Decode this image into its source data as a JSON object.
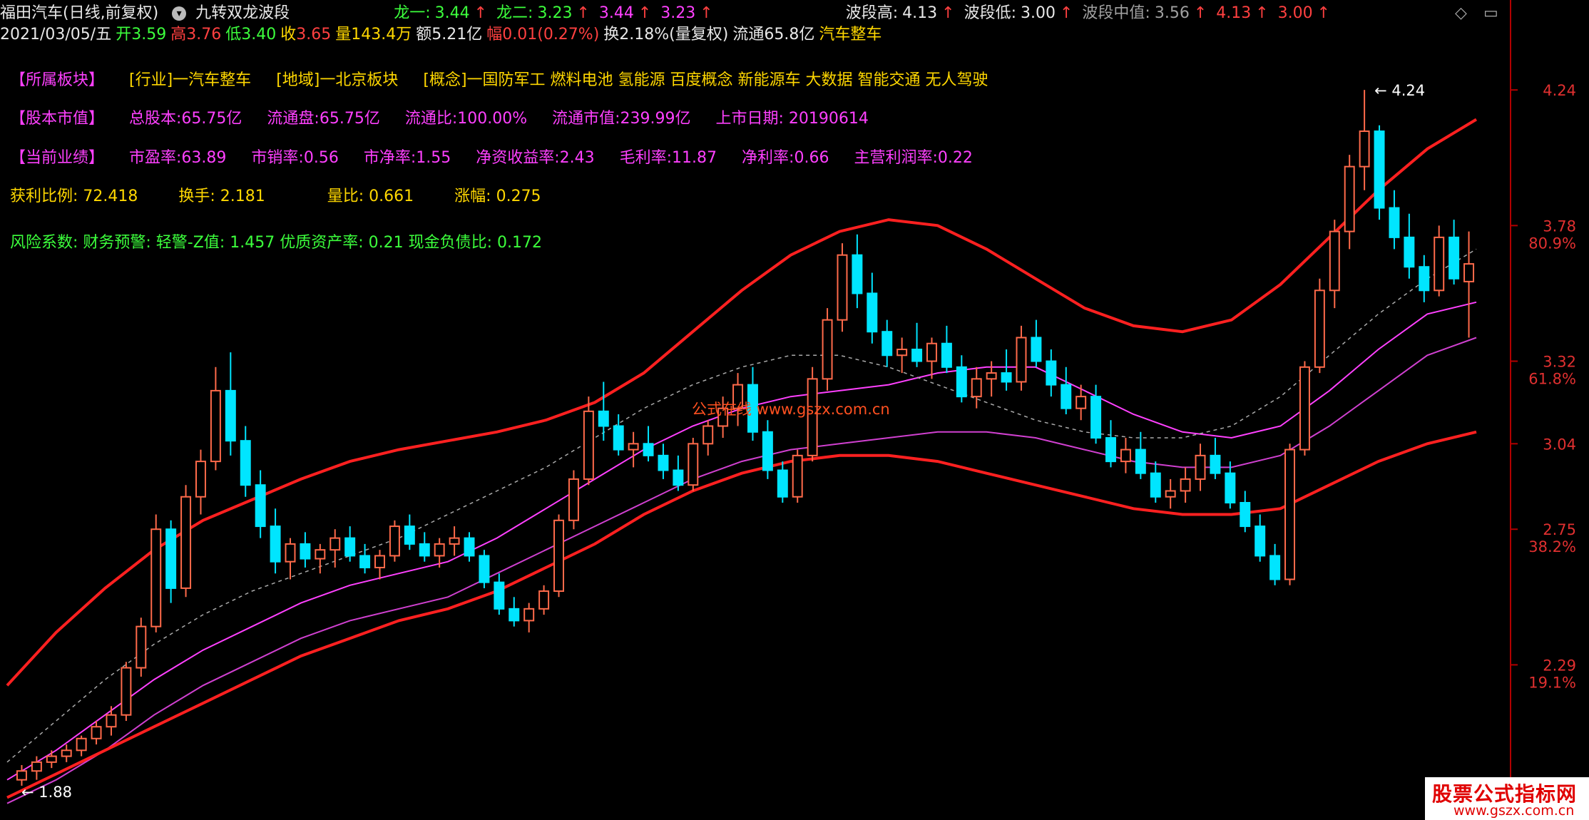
{
  "header": {
    "stock_name": "福田汽车(日线,前复权)",
    "indicator_name": "九转双龙波段",
    "long1_label": "龙一:",
    "long1_value": "3.44",
    "long2_label": "龙二:",
    "long2_value": "3.23",
    "extra1": "3.44",
    "extra2": "3.23",
    "wave_high_label": "波段高:",
    "wave_high_value": "4.13",
    "wave_low_label": "波段低:",
    "wave_low_value": "3.00",
    "wave_mid_label": "波段中值:",
    "wave_mid_value": "3.56",
    "extra3": "4.13",
    "extra4": "3.00",
    "arrow": "↑"
  },
  "quote": {
    "date": "2021/03/05/五",
    "open_label": "开",
    "open": "3.59",
    "high_label": "高",
    "high": "3.76",
    "low_label": "低",
    "low": "3.40",
    "close_label": "收",
    "close": "3.65",
    "vol_label": "量",
    "vol": "143.4万",
    "amount_label": "额",
    "amount": "5.21亿",
    "change_label": "幅",
    "change": "0.01(0.27%)",
    "turnover": "换2.18%(量复权)",
    "float": "流通65.8亿",
    "sector": "汽车整车"
  },
  "info": {
    "board_title": "【所属板块】",
    "industry": "[行业]一汽车整车",
    "region": "[地域]一北京板块",
    "concept": "[概念]一国防军工 燃料电池 氢能源 百度概念 新能源车 大数据 智能交通 无人驾驶",
    "capital_title": "【股本市值】",
    "total_shares": "总股本:65.75亿",
    "float_shares": "流通盘:65.75亿",
    "float_ratio": "流通比:100.00%",
    "float_cap": "流通市值:239.99亿",
    "list_date": "上市日期: 20190614",
    "perf_title": "【当前业绩】",
    "pe": "市盈率:63.89",
    "ps": "市销率:0.56",
    "pb": "市净率:1.55",
    "roe": "净资收益率:2.43",
    "gross": "毛利率:11.87",
    "net": "净利率:0.66",
    "main_profit": "主营利润率:0.22",
    "profit_ratio": "获利比例: 72.418",
    "turnover": "换手: 2.181",
    "vol_ratio": "量比: 0.661",
    "pct": "涨幅: 0.275",
    "risk": "风险系数: 财务预警: 轻警-Z值: 1.457 优质资产率: 0.21 现金负债比: 0.172"
  },
  "watermark": "公式在线  www.gszx.com.cn",
  "badge": {
    "title": "股票公式指标网",
    "url": "www.gszx.com.cn"
  },
  "controls": {
    "diamond": "◇",
    "window": "▭"
  },
  "chart_data": {
    "type": "candlestick",
    "y_axis_ticks": [
      {
        "price": 4.24,
        "label": "4.24"
      },
      {
        "price": 3.78,
        "label": "3.78",
        "pct": "80.9%"
      },
      {
        "price": 3.32,
        "label": "3.32",
        "pct": "61.8%"
      },
      {
        "price": 3.04,
        "label": "3.04"
      },
      {
        "price": 2.75,
        "label": "2.75",
        "pct": "38.2%"
      },
      {
        "price": 2.29,
        "label": "2.29",
        "pct": "19.1%"
      }
    ],
    "high_mark": "4.24",
    "low_mark": "1.88",
    "ylim": [
      1.8,
      4.4
    ],
    "candles": [
      [
        1.9,
        1.95,
        1.88,
        1.93
      ],
      [
        1.93,
        1.98,
        1.9,
        1.96
      ],
      [
        1.96,
        2.0,
        1.94,
        1.98
      ],
      [
        1.98,
        2.02,
        1.96,
        2.0
      ],
      [
        2.0,
        2.05,
        1.98,
        2.04
      ],
      [
        2.04,
        2.1,
        2.02,
        2.08
      ],
      [
        2.08,
        2.15,
        2.05,
        2.12
      ],
      [
        2.12,
        2.3,
        2.1,
        2.28
      ],
      [
        2.28,
        2.45,
        2.25,
        2.42
      ],
      [
        2.42,
        2.8,
        2.4,
        2.75
      ],
      [
        2.75,
        2.78,
        2.5,
        2.55
      ],
      [
        2.55,
        2.9,
        2.52,
        2.86
      ],
      [
        2.86,
        3.02,
        2.8,
        2.98
      ],
      [
        2.98,
        3.3,
        2.95,
        3.22
      ],
      [
        3.22,
        3.35,
        3.0,
        3.05
      ],
      [
        3.05,
        3.1,
        2.86,
        2.9
      ],
      [
        2.9,
        2.95,
        2.72,
        2.76
      ],
      [
        2.76,
        2.82,
        2.6,
        2.64
      ],
      [
        2.64,
        2.72,
        2.58,
        2.7
      ],
      [
        2.7,
        2.74,
        2.62,
        2.65
      ],
      [
        2.65,
        2.7,
        2.6,
        2.68
      ],
      [
        2.68,
        2.75,
        2.62,
        2.72
      ],
      [
        2.72,
        2.76,
        2.64,
        2.66
      ],
      [
        2.66,
        2.7,
        2.6,
        2.62
      ],
      [
        2.62,
        2.68,
        2.58,
        2.66
      ],
      [
        2.66,
        2.78,
        2.64,
        2.76
      ],
      [
        2.76,
        2.8,
        2.68,
        2.7
      ],
      [
        2.7,
        2.74,
        2.64,
        2.66
      ],
      [
        2.66,
        2.72,
        2.62,
        2.7
      ],
      [
        2.7,
        2.76,
        2.66,
        2.72
      ],
      [
        2.72,
        2.74,
        2.64,
        2.66
      ],
      [
        2.66,
        2.68,
        2.55,
        2.57
      ],
      [
        2.57,
        2.6,
        2.46,
        2.48
      ],
      [
        2.48,
        2.52,
        2.42,
        2.44
      ],
      [
        2.44,
        2.5,
        2.4,
        2.48
      ],
      [
        2.48,
        2.56,
        2.46,
        2.54
      ],
      [
        2.54,
        2.8,
        2.52,
        2.78
      ],
      [
        2.78,
        2.95,
        2.75,
        2.92
      ],
      [
        2.92,
        3.2,
        2.9,
        3.15
      ],
      [
        3.15,
        3.25,
        3.05,
        3.1
      ],
      [
        3.1,
        3.14,
        3.0,
        3.02
      ],
      [
        3.02,
        3.08,
        2.96,
        3.04
      ],
      [
        3.04,
        3.1,
        2.98,
        3.0
      ],
      [
        3.0,
        3.04,
        2.92,
        2.95
      ],
      [
        2.95,
        3.0,
        2.88,
        2.9
      ],
      [
        2.9,
        3.06,
        2.88,
        3.04
      ],
      [
        3.04,
        3.12,
        3.0,
        3.1
      ],
      [
        3.1,
        3.2,
        3.06,
        3.16
      ],
      [
        3.16,
        3.28,
        3.1,
        3.24
      ],
      [
        3.24,
        3.3,
        3.05,
        3.08
      ],
      [
        3.08,
        3.12,
        2.92,
        2.95
      ],
      [
        2.95,
        2.98,
        2.84,
        2.86
      ],
      [
        2.86,
        3.02,
        2.84,
        3.0
      ],
      [
        3.0,
        3.3,
        2.98,
        3.26
      ],
      [
        3.26,
        3.5,
        3.22,
        3.46
      ],
      [
        3.46,
        3.72,
        3.42,
        3.68
      ],
      [
        3.68,
        3.75,
        3.5,
        3.55
      ],
      [
        3.55,
        3.62,
        3.38,
        3.42
      ],
      [
        3.42,
        3.46,
        3.3,
        3.34
      ],
      [
        3.34,
        3.4,
        3.28,
        3.36
      ],
      [
        3.36,
        3.45,
        3.3,
        3.32
      ],
      [
        3.32,
        3.4,
        3.26,
        3.38
      ],
      [
        3.38,
        3.44,
        3.28,
        3.3
      ],
      [
        3.3,
        3.34,
        3.18,
        3.2
      ],
      [
        3.2,
        3.3,
        3.16,
        3.26
      ],
      [
        3.26,
        3.32,
        3.2,
        3.28
      ],
      [
        3.28,
        3.36,
        3.22,
        3.25
      ],
      [
        3.25,
        3.44,
        3.22,
        3.4
      ],
      [
        3.4,
        3.46,
        3.3,
        3.32
      ],
      [
        3.32,
        3.36,
        3.2,
        3.24
      ],
      [
        3.24,
        3.3,
        3.14,
        3.16
      ],
      [
        3.16,
        3.24,
        3.12,
        3.2
      ],
      [
        3.2,
        3.24,
        3.04,
        3.06
      ],
      [
        3.06,
        3.12,
        2.96,
        2.98
      ],
      [
        2.98,
        3.06,
        2.94,
        3.02
      ],
      [
        3.02,
        3.08,
        2.92,
        2.94
      ],
      [
        2.94,
        2.98,
        2.84,
        2.86
      ],
      [
        2.86,
        2.92,
        2.82,
        2.88
      ],
      [
        2.88,
        2.96,
        2.84,
        2.92
      ],
      [
        2.92,
        3.04,
        2.88,
        3.0
      ],
      [
        3.0,
        3.06,
        2.92,
        2.94
      ],
      [
        2.94,
        2.98,
        2.82,
        2.84
      ],
      [
        2.84,
        2.88,
        2.74,
        2.76
      ],
      [
        2.76,
        2.8,
        2.64,
        2.66
      ],
      [
        2.66,
        2.7,
        2.56,
        2.58
      ],
      [
        2.58,
        3.04,
        2.56,
        3.02
      ],
      [
        3.02,
        3.32,
        3.0,
        3.3
      ],
      [
        3.3,
        3.6,
        3.28,
        3.56
      ],
      [
        3.56,
        3.8,
        3.5,
        3.76
      ],
      [
        3.76,
        4.02,
        3.7,
        3.98
      ],
      [
        3.98,
        4.24,
        3.9,
        4.1
      ],
      [
        4.1,
        4.12,
        3.8,
        3.84
      ],
      [
        3.84,
        3.9,
        3.7,
        3.74
      ],
      [
        3.74,
        3.82,
        3.6,
        3.64
      ],
      [
        3.64,
        3.68,
        3.52,
        3.56
      ],
      [
        3.56,
        3.78,
        3.54,
        3.74
      ],
      [
        3.74,
        3.8,
        3.58,
        3.6
      ],
      [
        3.59,
        3.76,
        3.4,
        3.65
      ]
    ],
    "upper_band": [
      2.22,
      2.4,
      2.55,
      2.68,
      2.78,
      2.85,
      2.92,
      2.98,
      3.02,
      3.05,
      3.08,
      3.12,
      3.18,
      3.28,
      3.42,
      3.56,
      3.68,
      3.76,
      3.8,
      3.78,
      3.7,
      3.6,
      3.5,
      3.44,
      3.42,
      3.46,
      3.58,
      3.74,
      3.9,
      4.04,
      4.14
    ],
    "lower_band": [
      1.84,
      1.92,
      2.0,
      2.08,
      2.16,
      2.24,
      2.32,
      2.38,
      2.44,
      2.48,
      2.54,
      2.62,
      2.7,
      2.8,
      2.88,
      2.94,
      2.98,
      3.0,
      3.0,
      2.98,
      2.94,
      2.9,
      2.86,
      2.82,
      2.8,
      2.8,
      2.82,
      2.9,
      2.98,
      3.04,
      3.08
    ],
    "mid_line": [
      1.96,
      2.1,
      2.24,
      2.36,
      2.46,
      2.54,
      2.6,
      2.66,
      2.72,
      2.8,
      2.88,
      2.96,
      3.06,
      3.16,
      3.24,
      3.3,
      3.34,
      3.34,
      3.3,
      3.24,
      3.18,
      3.12,
      3.08,
      3.06,
      3.06,
      3.1,
      3.2,
      3.34,
      3.48,
      3.6,
      3.7
    ],
    "magenta_upper": [
      1.9,
      2.0,
      2.12,
      2.24,
      2.34,
      2.42,
      2.5,
      2.56,
      2.6,
      2.64,
      2.72,
      2.82,
      2.92,
      3.02,
      3.1,
      3.16,
      3.2,
      3.22,
      3.24,
      3.28,
      3.3,
      3.3,
      3.22,
      3.14,
      3.08,
      3.06,
      3.1,
      3.22,
      3.36,
      3.48,
      3.52
    ],
    "magenta_lower": [
      1.82,
      1.9,
      2.0,
      2.12,
      2.22,
      2.3,
      2.38,
      2.44,
      2.48,
      2.52,
      2.6,
      2.68,
      2.76,
      2.84,
      2.92,
      2.98,
      3.02,
      3.04,
      3.06,
      3.08,
      3.08,
      3.06,
      3.02,
      2.98,
      2.96,
      2.96,
      3.0,
      3.1,
      3.22,
      3.34,
      3.4
    ]
  }
}
